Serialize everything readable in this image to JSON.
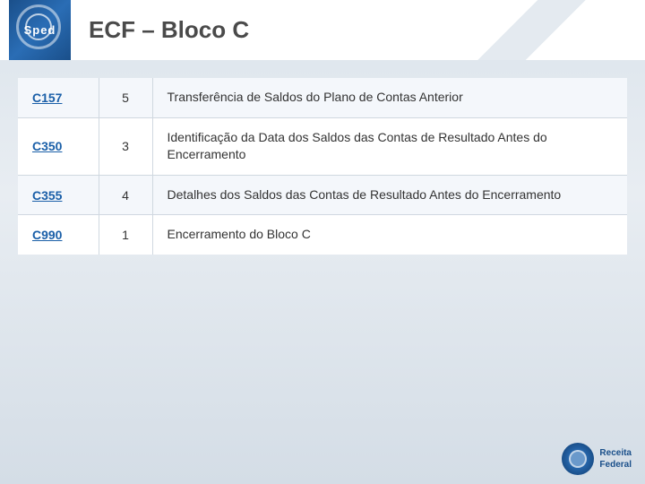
{
  "header": {
    "logo_text": "Sped",
    "title": "ECF – Bloco C"
  },
  "table": {
    "rows": [
      {
        "code": "C157",
        "number": "5",
        "description": "Transferência de Saldos do Plano de Contas Anterior"
      },
      {
        "code": "C350",
        "number": "3",
        "description": "Identificação da Data dos Saldos das Contas de Resultado Antes do Encerramento"
      },
      {
        "code": "C355",
        "number": "4",
        "description": "Detalhes dos Saldos das Contas de Resultado Antes do Encerramento"
      },
      {
        "code": "C990",
        "number": "1",
        "description": "Encerramento do Bloco C"
      }
    ]
  },
  "footer": {
    "receita_line1": "Receita",
    "receita_line2": "Federal"
  }
}
